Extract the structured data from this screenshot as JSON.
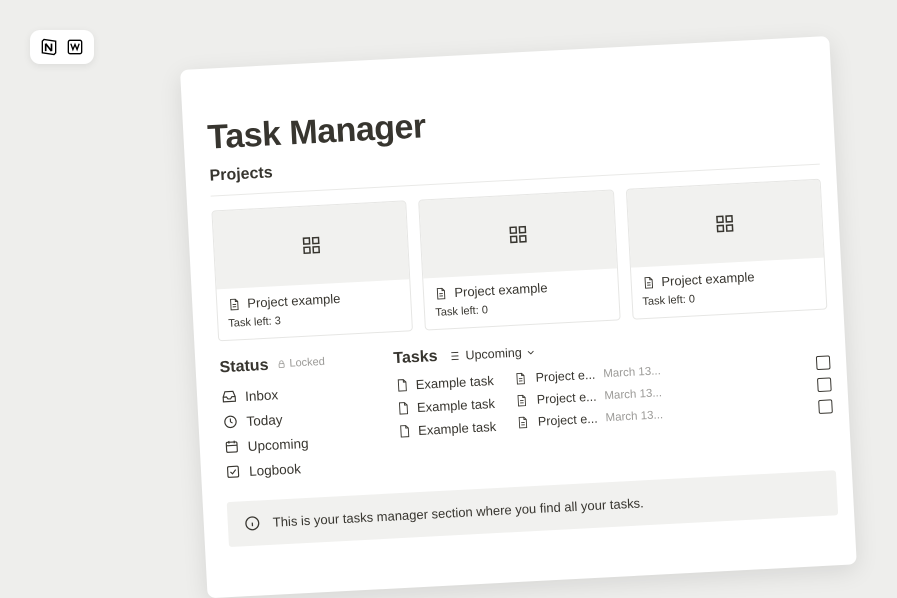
{
  "page": {
    "title": "Task Manager",
    "projects_heading": "Projects",
    "status_heading": "Status",
    "locked_label": "Locked",
    "tasks_heading": "Tasks",
    "view_label": "Upcoming",
    "callout_text": "This is your tasks manager section where you find all your tasks."
  },
  "projects": [
    {
      "title": "Project example",
      "subtext": "Task left: 3"
    },
    {
      "title": "Project example",
      "subtext": "Task left: 0"
    },
    {
      "title": "Project example",
      "subtext": "Task left: 0"
    }
  ],
  "status_items": [
    {
      "icon": "inbox-icon",
      "label": "Inbox"
    },
    {
      "icon": "clock-icon",
      "label": "Today"
    },
    {
      "icon": "calendar-icon",
      "label": "Upcoming"
    },
    {
      "icon": "checkbox-icon",
      "label": "Logbook"
    }
  ],
  "tasks_left": [
    {
      "label": "Example task"
    },
    {
      "label": "Example task"
    },
    {
      "label": "Example task"
    }
  ],
  "tasks_right": [
    {
      "name": "Project e...",
      "date": "March 13..."
    },
    {
      "name": "Project e...",
      "date": "March 13..."
    },
    {
      "name": "Project e...",
      "date": "March 13..."
    }
  ]
}
